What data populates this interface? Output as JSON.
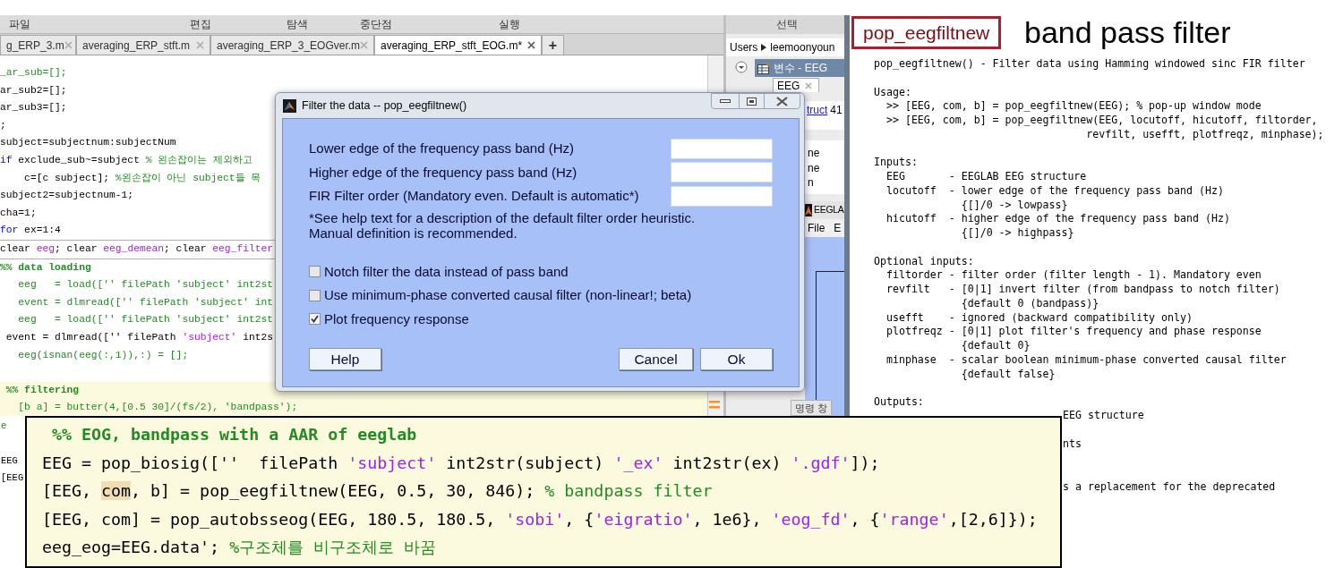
{
  "editor": {
    "menu": [
      "파일",
      "편집",
      "탐색",
      "중단점",
      "실행"
    ],
    "tabs": [
      {
        "label": "g_ERP_3.m",
        "selected": false
      },
      {
        "label": "averaging_ERP_stft.m",
        "selected": false
      },
      {
        "label": "averaging_ERP_3_EOGver.m",
        "selected": false
      },
      {
        "label": "averaging_ERP_stft_EOG.m*",
        "selected": true
      }
    ],
    "new_tab": "+",
    "lines": [
      {
        "segments": [
          {
            "kind": "comment",
            "text": "_ar_sub=[];"
          }
        ]
      },
      {
        "segments": [
          {
            "kind": "code",
            "text": "ar_sub2=[];"
          }
        ]
      },
      {
        "segments": [
          {
            "kind": "code",
            "text": "ar_sub3=[];"
          }
        ]
      },
      {
        "segments": [
          {
            "kind": "code",
            "text": ";"
          }
        ]
      },
      {
        "segments": [
          {
            "kind": "code",
            "text": "subject=subjectnum:subjectNum"
          }
        ]
      },
      {
        "segments": [
          {
            "kind": "keyword",
            "text": "if"
          },
          {
            "kind": "code",
            "text": " exclude_sub~=subject "
          },
          {
            "kind": "comment",
            "text": "% 왼손잡이는 제외하고"
          }
        ]
      },
      {
        "segments": [
          {
            "kind": "code",
            "text": "    c=[c subject]; "
          },
          {
            "kind": "comment",
            "text": "%왼손잡이 아닌 subject들 목"
          }
        ]
      },
      {
        "segments": [
          {
            "kind": "code",
            "text": "subject2=subjectnum-1;"
          }
        ]
      },
      {
        "segments": [
          {
            "kind": "code",
            "text": "cha=1;"
          }
        ]
      },
      {
        "segments": [
          {
            "kind": "keyword",
            "text": "for"
          },
          {
            "kind": "code",
            "text": " ex=1:4"
          }
        ]
      },
      {
        "rule_above": true,
        "segments": [
          {
            "kind": "code",
            "text": "clear "
          },
          {
            "kind": "string",
            "text": "eeg"
          },
          {
            "kind": "code",
            "text": "; clear "
          },
          {
            "kind": "string",
            "text": "eeg_demean"
          },
          {
            "kind": "code",
            "text": "; clear "
          },
          {
            "kind": "string",
            "text": "eeg_filter"
          }
        ]
      },
      {
        "rule_above": true,
        "segments": [
          {
            "kind": "section",
            "text": "%% data loading"
          }
        ]
      },
      {
        "segments": [
          {
            "kind": "comment",
            "text": "   eeg   = load(['' filePath 'subject' int2st"
          }
        ]
      },
      {
        "segments": [
          {
            "kind": "comment",
            "text": "   event = dlmread(['' filePath 'subject' int"
          }
        ]
      },
      {
        "segments": [
          {
            "kind": "comment",
            "text": "   eeg   = load(['' filePath 'subject' int2st"
          }
        ]
      },
      {
        "segments": [
          {
            "kind": "code",
            "text": " event = dlmread(['' filePath "
          },
          {
            "kind": "string",
            "text": "'subject'"
          },
          {
            "kind": "code",
            "text": " int2s"
          }
        ]
      },
      {
        "segments": [
          {
            "kind": "comment",
            "text": "   eeg(isnan(eeg(:,1)),:) = [];"
          }
        ]
      },
      {
        "cell": true,
        "segments": [
          {
            "kind": "section",
            "text": " %% filtering"
          }
        ]
      },
      {
        "cell": true,
        "segments": [
          {
            "kind": "comment",
            "text": "   [b a] = butter(4,[0.5 30]/(fs/2), 'bandpass');"
          }
        ]
      }
    ],
    "hidden_line_starts": [
      "e",
      "EEG",
      "[EEG"
    ]
  },
  "workspace": {
    "header": "선택",
    "path": [
      "Users",
      "leemoonyoun"
    ],
    "variables_title": "변수 - EEG",
    "variable_tab": "EEG",
    "struct_link": "truct",
    "struct_size": "41",
    "fields": [
      "ne",
      "ne",
      "n"
    ],
    "eeglab_title": "EEGLA",
    "eeglab_menu": [
      "File",
      "E"
    ],
    "command_window": "명령 창"
  },
  "dialog": {
    "title": "Filter the data -- pop_eegfiltnew()",
    "fields": [
      {
        "label": "Lower edge of the frequency pass band (Hz)"
      },
      {
        "label": "Higher edge of the frequency pass band (Hz)"
      },
      {
        "label": "FIR Filter order (Mandatory even. Default is automatic*)"
      }
    ],
    "note": [
      "*See help text for a description of the default filter order heuristic.",
      "Manual definition is recommended."
    ],
    "checkboxes": [
      {
        "label": "Notch filter the data instead of pass band",
        "checked": false
      },
      {
        "label": "Use minimum-phase converted causal filter (non-linear!; beta)",
        "checked": false
      },
      {
        "label": "Plot frequency response",
        "checked": true
      }
    ],
    "buttons": [
      "Help",
      "Cancel",
      "Ok"
    ]
  },
  "help": {
    "function_name": "pop_eegfiltnew",
    "caption": "band pass filter",
    "summary": "pop_eegfiltnew() - Filter data using Hamming windowed sinc FIR filter",
    "sections": [
      {
        "heading": "Usage:",
        "lines": [
          "  >> [EEG, com, b] = pop_eegfiltnew(EEG); % pop-up window mode",
          "  >> [EEG, com, b] = pop_eegfiltnew(EEG, locutoff, hicutoff, filtorder,",
          "                                  revfilt, usefft, plotfreqz, minphase);"
        ]
      },
      {
        "heading": "Inputs:",
        "lines": [
          "  EEG       - EEGLAB EEG structure",
          "  locutoff  - lower edge of the frequency pass band (Hz)",
          "              {[]/0 -> lowpass}",
          "  hicutoff  - higher edge of the frequency pass band (Hz)",
          "              {[]/0 -> highpass}"
        ]
      },
      {
        "heading": "Optional inputs:",
        "lines": [
          "  filtorder - filter order (filter length - 1). Mandatory even",
          "  revfilt   - [0|1] invert filter (from bandpass to notch filter)",
          "              {default 0 (bandpass)}",
          "  usefft    - ignored (backward compatibility only)",
          "  plotfreqz - [0|1] plot filter's frequency and phase response",
          "              {default 0}",
          "  minphase  - scalar boolean minimum-phase converted causal filter",
          "              {default false}"
        ]
      },
      {
        "heading": "Outputs:"
      }
    ],
    "fragments": [
      "EEG structure",
      "nts",
      "s a replacement for the deprecated"
    ]
  },
  "snippet": {
    "lines": [
      {
        "segments": [
          {
            "kind": "section",
            "text": " %% EOG, bandpass with a AAR of eeglab"
          }
        ]
      },
      {
        "segments": [
          {
            "kind": "code",
            "text": "EEG = pop_biosig([''  filePath "
          },
          {
            "kind": "string",
            "text": "'subject'"
          },
          {
            "kind": "code",
            "text": " int2str(subject) "
          },
          {
            "kind": "string",
            "text": "'_ex'"
          },
          {
            "kind": "code",
            "text": " int2str(ex) "
          },
          {
            "kind": "string",
            "text": "'.gdf'"
          },
          {
            "kind": "code",
            "text": "]);"
          }
        ]
      },
      {
        "segments": [
          {
            "kind": "code",
            "text": "[EEG, "
          },
          {
            "kind": "highlight",
            "text": "com"
          },
          {
            "kind": "code",
            "text": ", b] = pop_eegfiltnew(EEG, 0.5, 30, 846); "
          },
          {
            "kind": "comment",
            "text": "% bandpass filter"
          }
        ]
      },
      {
        "segments": [
          {
            "kind": "code",
            "text": "[EEG, com] = pop_autobsseog(EEG, 180.5, 180.5, "
          },
          {
            "kind": "string",
            "text": "'sobi'"
          },
          {
            "kind": "code",
            "text": ", {"
          },
          {
            "kind": "string",
            "text": "'eigratio'"
          },
          {
            "kind": "code",
            "text": ", 1e6}, "
          },
          {
            "kind": "string",
            "text": "'eog_fd'"
          },
          {
            "kind": "code",
            "text": ", {"
          },
          {
            "kind": "string",
            "text": "'range'"
          },
          {
            "kind": "code",
            "text": ",[2,6]});"
          }
        ]
      },
      {
        "segments": [
          {
            "kind": "code",
            "text": "eeg_eog=EEG.data'; "
          },
          {
            "kind": "comment",
            "text": "%구조체를 비구조체로 바꿈"
          }
        ]
      }
    ]
  }
}
